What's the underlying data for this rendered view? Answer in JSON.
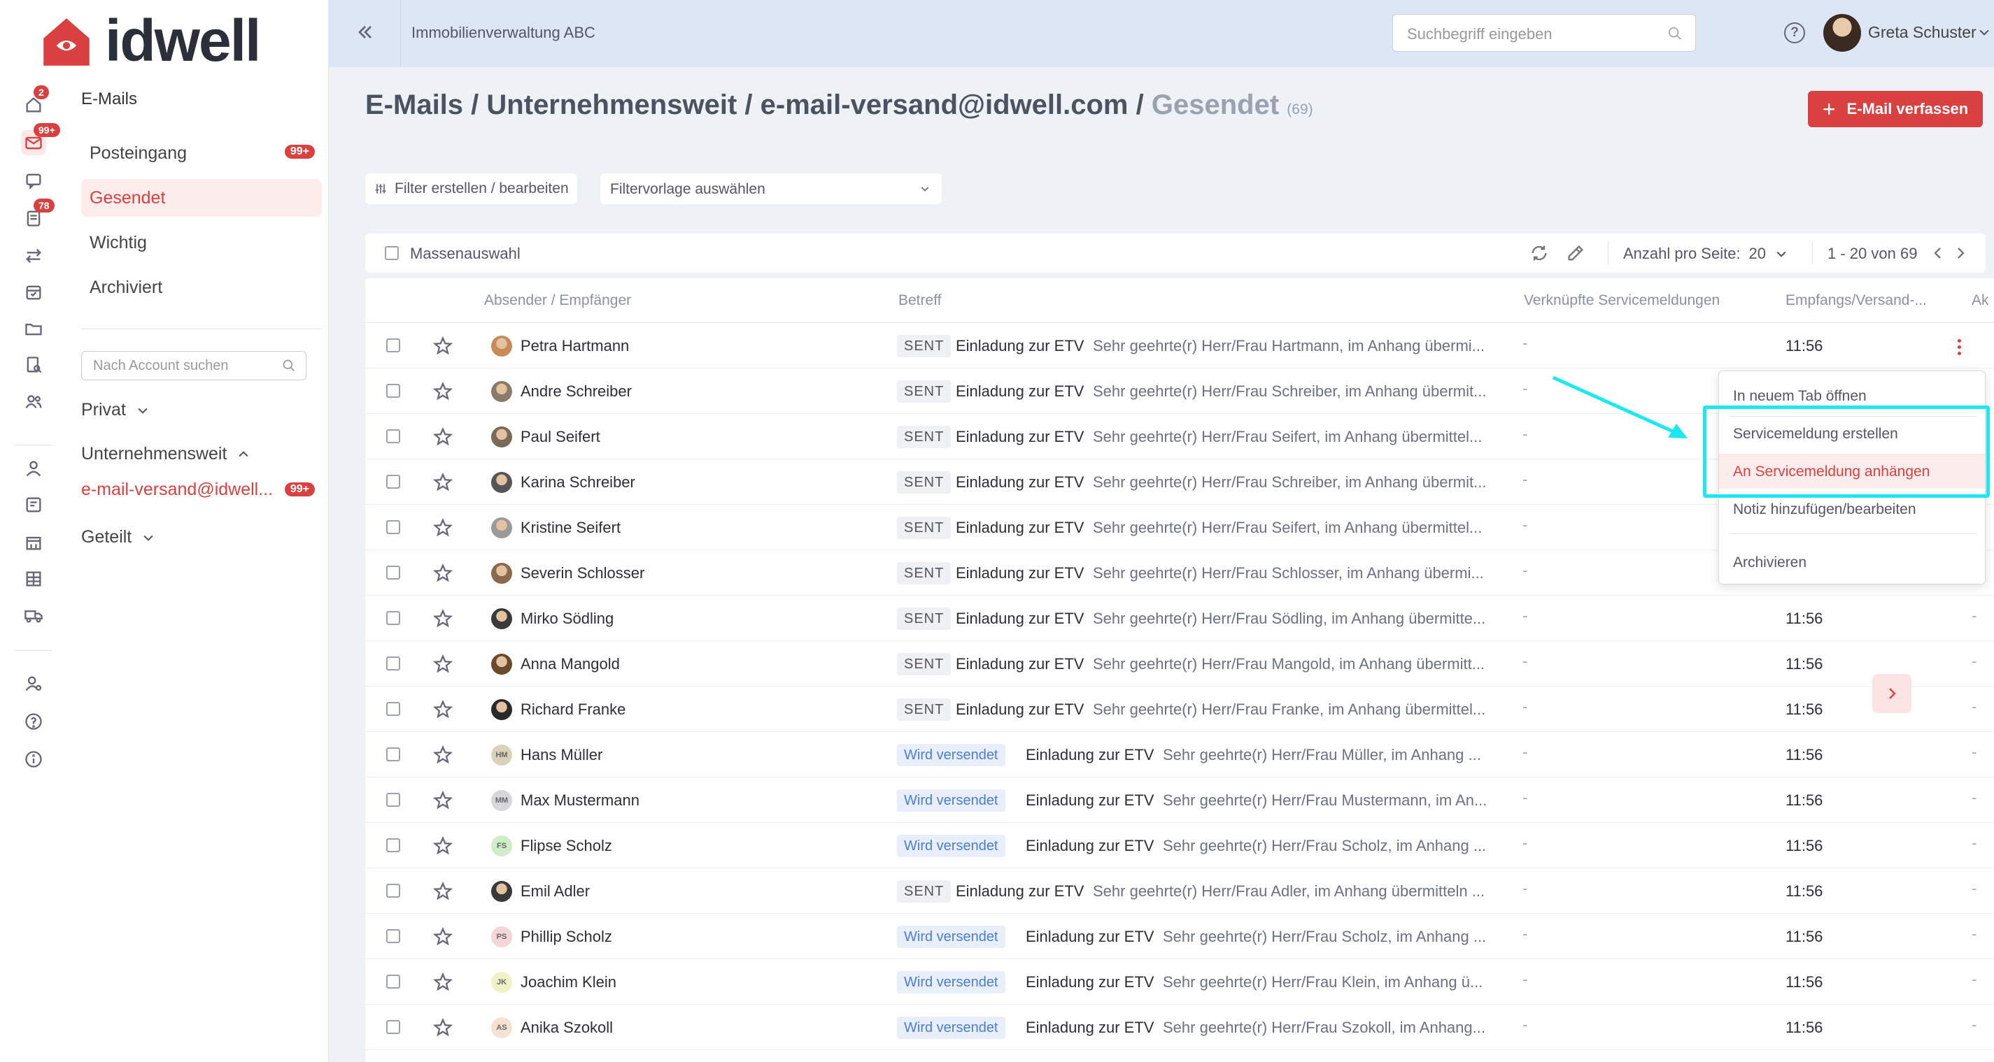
{
  "brand": {
    "name": "idwell",
    "accent": "#d94141"
  },
  "rail": {
    "items": [
      {
        "icon": "home-icon",
        "badge": "2"
      },
      {
        "icon": "mail-icon",
        "badge": "99+",
        "active": true
      },
      {
        "icon": "chat-icon"
      },
      {
        "icon": "tasks-icon",
        "badge": "78"
      },
      {
        "icon": "transfer-icon"
      },
      {
        "icon": "calendar-icon"
      },
      {
        "icon": "folder-icon"
      },
      {
        "icon": "document-search-icon"
      },
      {
        "icon": "users-icon"
      },
      {
        "icon": "person-icon"
      },
      {
        "icon": "contract-icon"
      },
      {
        "icon": "building-icon"
      },
      {
        "icon": "ledger-icon"
      },
      {
        "icon": "truck-icon"
      },
      {
        "icon": "user-settings-icon"
      },
      {
        "icon": "help-icon"
      },
      {
        "icon": "info-icon"
      }
    ]
  },
  "sidebar": {
    "title": "E-Mails",
    "folders": [
      {
        "label": "Posteingang",
        "count": "99+"
      },
      {
        "label": "Gesendet",
        "active": true
      },
      {
        "label": "Wichtig"
      },
      {
        "label": "Archiviert"
      }
    ],
    "account_search_placeholder": "Nach Account suchen",
    "groups": {
      "private": "Privat",
      "company": "Unternehmensweit",
      "shared": "Geteilt"
    },
    "account": {
      "label": "e-mail-versand@idwell...",
      "count": "99+"
    }
  },
  "topbar": {
    "organization": "Immobilienverwaltung ABC",
    "search_placeholder": "Suchbegriff eingeben",
    "help": "?",
    "user_name": "Greta Schuster"
  },
  "breadcrumb": {
    "parts": [
      "E-Mails",
      "Unternehmensweit",
      "e-mail-versand@idwell.com"
    ],
    "separator": "/",
    "current": "Gesendet",
    "count": "(69)"
  },
  "compose_label": "E-Mail verfassen",
  "filters": {
    "edit_label": "Filter erstellen / bearbeiten",
    "template_placeholder": "Filtervorlage auswählen"
  },
  "toolbar": {
    "mass_select": "Massenauswahl",
    "per_page_label": "Anzahl pro Seite:",
    "per_page_value": "20",
    "range": "1 - 20 von 69"
  },
  "columns": {
    "sender": "Absender / Empfänger",
    "subject": "Betreff",
    "linked": "Verknüpfte Servicemeldungen",
    "date": "Empfangs/Versand-...",
    "actions": "Ak"
  },
  "rows": [
    {
      "name": "Petra Hartmann",
      "status": "SENT",
      "subject": "Einladung zur ETV",
      "preview": "Sehr geehrte(r) Herr/Frau Hartmann, im Anhang übermi...",
      "linked": "-",
      "time": "11:56",
      "avatar_type": "photo",
      "avatar_color": "#c98a5a"
    },
    {
      "name": "Andre Schreiber",
      "status": "SENT",
      "subject": "Einladung zur ETV",
      "preview": "Sehr geehrte(r) Herr/Frau Schreiber, im Anhang übermit...",
      "linked": "-",
      "time": "",
      "avatar_type": "photo",
      "avatar_color": "#8a7a6a"
    },
    {
      "name": "Paul Seifert",
      "status": "SENT",
      "subject": "Einladung zur ETV",
      "preview": "Sehr geehrte(r) Herr/Frau Seifert, im Anhang übermittel...",
      "linked": "-",
      "time": "",
      "avatar_type": "photo",
      "avatar_color": "#7a6a5a"
    },
    {
      "name": "Karina Schreiber",
      "status": "SENT",
      "subject": "Einladung zur ETV",
      "preview": "Sehr geehrte(r) Herr/Frau Schreiber, im Anhang übermit...",
      "linked": "-",
      "time": "",
      "avatar_type": "photo",
      "avatar_color": "#555555"
    },
    {
      "name": "Kristine Seifert",
      "status": "SENT",
      "subject": "Einladung zur ETV",
      "preview": "Sehr geehrte(r) Herr/Frau Seifert, im Anhang übermittel...",
      "linked": "-",
      "time": "",
      "avatar_type": "photo",
      "avatar_color": "#9a9a9a"
    },
    {
      "name": "Severin Schlosser",
      "status": "SENT",
      "subject": "Einladung zur ETV",
      "preview": "Sehr geehrte(r) Herr/Frau Schlosser, im Anhang übermi...",
      "linked": "-",
      "time": "",
      "avatar_type": "photo",
      "avatar_color": "#8a6a4a"
    },
    {
      "name": "Mirko Södling",
      "status": "SENT",
      "subject": "Einladung zur ETV",
      "preview": "Sehr geehrte(r) Herr/Frau Södling, im Anhang übermitte...",
      "linked": "-",
      "time": "11:56",
      "avatar_type": "photo",
      "avatar_color": "#3a3a3a"
    },
    {
      "name": "Anna Mangold",
      "status": "SENT",
      "subject": "Einladung zur ETV",
      "preview": "Sehr geehrte(r) Herr/Frau Mangold, im Anhang übermitt...",
      "linked": "-",
      "time": "11:56",
      "avatar_type": "photo",
      "avatar_color": "#6a4a2a"
    },
    {
      "name": "Richard Franke",
      "status": "SENT",
      "subject": "Einladung zur ETV",
      "preview": "Sehr geehrte(r) Herr/Frau Franke, im Anhang übermittel...",
      "linked": "-",
      "time": "11:56",
      "avatar_type": "photo",
      "avatar_color": "#2a2a2a"
    },
    {
      "name": "Hans Müller",
      "status": "Wird versendet",
      "subject": "Einladung zur ETV",
      "preview": "Sehr geehrte(r) Herr/Frau Müller, im Anhang ...",
      "linked": "-",
      "time": "11:56",
      "avatar_type": "initials",
      "initials": "HM",
      "avatar_color": "#d9d2b8"
    },
    {
      "name": "Max Mustermann",
      "status": "Wird versendet",
      "subject": "Einladung zur ETV",
      "preview": "Sehr geehrte(r) Herr/Frau Mustermann, im An...",
      "linked": "-",
      "time": "11:56",
      "avatar_type": "initials",
      "initials": "MM",
      "avatar_color": "#d6d6dc"
    },
    {
      "name": "Flipse Scholz",
      "status": "Wird versendet",
      "subject": "Einladung zur ETV",
      "preview": "Sehr geehrte(r) Herr/Frau Scholz, im Anhang ...",
      "linked": "-",
      "time": "11:56",
      "avatar_type": "initials",
      "initials": "FS",
      "avatar_color": "#cfeec8"
    },
    {
      "name": "Emil Adler",
      "status": "SENT",
      "subject": "Einladung zur ETV",
      "preview": "Sehr geehrte(r) Herr/Frau Adler, im Anhang übermitteln ...",
      "linked": "-",
      "time": "11:56",
      "avatar_type": "photo",
      "avatar_color": "#3a3a3a"
    },
    {
      "name": "Phillip Scholz",
      "status": "Wird versendet",
      "subject": "Einladung zur ETV",
      "preview": "Sehr geehrte(r) Herr/Frau Scholz, im Anhang ...",
      "linked": "-",
      "time": "11:56",
      "avatar_type": "initials",
      "initials": "PS",
      "avatar_color": "#f3d6d6"
    },
    {
      "name": "Joachim Klein",
      "status": "Wird versendet",
      "subject": "Einladung zur ETV",
      "preview": "Sehr geehrte(r) Herr/Frau Klein, im Anhang ü...",
      "linked": "-",
      "time": "11:56",
      "avatar_type": "initials",
      "initials": "JK",
      "avatar_color": "#eef2c4"
    },
    {
      "name": "Anika Szokoll",
      "status": "Wird versendet",
      "subject": "Einladung zur ETV",
      "preview": "Sehr geehrte(r) Herr/Frau Szokoll, im Anhang...",
      "linked": "-",
      "time": "11:56",
      "avatar_type": "initials",
      "initials": "AS",
      "avatar_color": "#f6e2d2"
    }
  ],
  "context_menu": {
    "items": [
      {
        "label": "In neuem Tab öffnen"
      },
      {
        "label": "Servicemeldung erstellen"
      },
      {
        "label": "An Servicemeldung anhängen",
        "highlighted": true
      },
      {
        "label": "Notiz hinzufügen/bearbeiten"
      },
      {
        "label": "Archivieren"
      }
    ]
  },
  "annotation_color": "#1de8f2"
}
